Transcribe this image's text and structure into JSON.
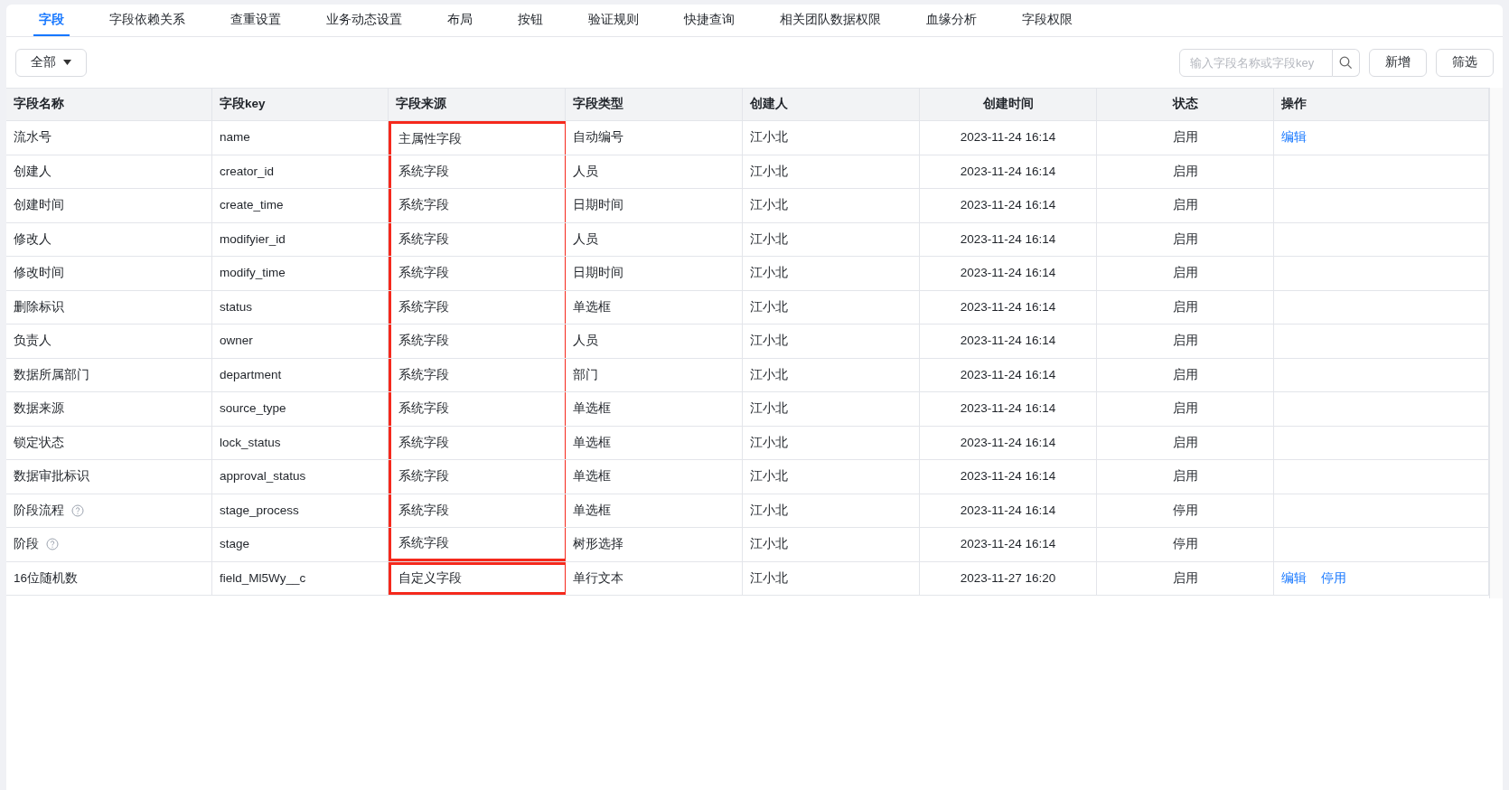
{
  "tabs": [
    {
      "label": "字段",
      "selected": true
    },
    {
      "label": "字段依赖关系",
      "selected": false
    },
    {
      "label": "查重设置",
      "selected": false
    },
    {
      "label": "业务动态设置",
      "selected": false
    },
    {
      "label": "布局",
      "selected": false
    },
    {
      "label": "按钮",
      "selected": false
    },
    {
      "label": "验证规则",
      "selected": false
    },
    {
      "label": "快捷查询",
      "selected": false
    },
    {
      "label": "相关团队数据权限",
      "selected": false
    },
    {
      "label": "血缘分析",
      "selected": false
    },
    {
      "label": "字段权限",
      "selected": false
    }
  ],
  "filter_dropdown": {
    "label": "全部"
  },
  "search": {
    "placeholder": "输入字段名称或字段key"
  },
  "buttons": [
    "新增",
    "筛选"
  ],
  "table": {
    "columns": [
      {
        "label": "字段名称"
      },
      {
        "label": "字段key"
      },
      {
        "label": "字段来源"
      },
      {
        "label": "字段类型"
      },
      {
        "label": "创建人"
      },
      {
        "label": "创建时间"
      },
      {
        "label": "状态"
      },
      {
        "label": "操作"
      }
    ],
    "rows": [
      {
        "name": "流水号",
        "help": false,
        "key": "name",
        "source": "主属性字段",
        "type": "自动编号",
        "creator": "江小北",
        "created": "2023-11-24 16:14",
        "status": "启用",
        "actions": [
          "编辑"
        ],
        "highlighted": true,
        "box_start": true
      },
      {
        "name": "创建人",
        "help": false,
        "key": "creator_id",
        "source": "系统字段",
        "type": "人员",
        "creator": "江小北",
        "created": "2023-11-24 16:14",
        "status": "启用",
        "actions": [],
        "highlighted": true,
        "box_start": false
      },
      {
        "name": "创建时间",
        "help": false,
        "key": "create_time",
        "source": "系统字段",
        "type": "日期时间",
        "creator": "江小北",
        "created": "2023-11-24 16:14",
        "status": "启用",
        "actions": [],
        "highlighted": true,
        "box_start": false
      },
      {
        "name": "修改人",
        "help": false,
        "key": "modifyier_id",
        "source": "系统字段",
        "type": "人员",
        "creator": "江小北",
        "created": "2023-11-24 16:14",
        "status": "启用",
        "actions": [],
        "highlighted": true,
        "box_start": false
      },
      {
        "name": "修改时间",
        "help": false,
        "key": "modify_time",
        "source": "系统字段",
        "type": "日期时间",
        "creator": "江小北",
        "created": "2023-11-24 16:14",
        "status": "启用",
        "actions": [],
        "highlighted": true,
        "box_start": false
      },
      {
        "name": "删除标识",
        "help": false,
        "key": "status",
        "source": "系统字段",
        "type": "单选框",
        "creator": "江小北",
        "created": "2023-11-24 16:14",
        "status": "启用",
        "actions": [],
        "highlighted": true,
        "box_start": false
      },
      {
        "name": "负责人",
        "help": false,
        "key": "owner",
        "source": "系统字段",
        "type": "人员",
        "creator": "江小北",
        "created": "2023-11-24 16:14",
        "status": "启用",
        "actions": [],
        "highlighted": true,
        "box_start": false
      },
      {
        "name": "数据所属部门",
        "help": false,
        "key": "department",
        "source": "系统字段",
        "type": "部门",
        "creator": "江小北",
        "created": "2023-11-24 16:14",
        "status": "启用",
        "actions": [],
        "highlighted": true,
        "box_start": false
      },
      {
        "name": "数据来源",
        "help": false,
        "key": "source_type",
        "source": "系统字段",
        "type": "单选框",
        "creator": "江小北",
        "created": "2023-11-24 16:14",
        "status": "启用",
        "actions": [],
        "highlighted": true,
        "box_start": false
      },
      {
        "name": "锁定状态",
        "help": false,
        "key": "lock_status",
        "source": "系统字段",
        "type": "单选框",
        "creator": "江小北",
        "created": "2023-11-24 16:14",
        "status": "启用",
        "actions": [],
        "highlighted": true,
        "box_start": false
      },
      {
        "name": "数据审批标识",
        "help": false,
        "key": "approval_status",
        "source": "系统字段",
        "type": "单选框",
        "creator": "江小北",
        "created": "2023-11-24 16:14",
        "status": "启用",
        "actions": [],
        "highlighted": true,
        "box_start": false
      },
      {
        "name": "阶段流程",
        "help": true,
        "key": "stage_process",
        "source": "系统字段",
        "type": "单选框",
        "creator": "江小北",
        "created": "2023-11-24 16:14",
        "status": "停用",
        "actions": [],
        "highlighted": true,
        "box_start": false
      },
      {
        "name": "阶段",
        "help": true,
        "key": "stage",
        "source": "系统字段",
        "type": "树形选择",
        "creator": "江小北",
        "created": "2023-11-24 16:14",
        "status": "停用",
        "actions": [],
        "highlighted": true,
        "box_start": false
      },
      {
        "name": "16位随机数",
        "help": false,
        "key": "field_Ml5Wy__c",
        "source": "自定义字段",
        "type": "单行文本",
        "creator": "江小北",
        "created": "2023-11-27 16:20",
        "status": "启用",
        "actions": [
          "编辑",
          "停用"
        ],
        "highlighted": true,
        "box_start": true
      }
    ]
  }
}
